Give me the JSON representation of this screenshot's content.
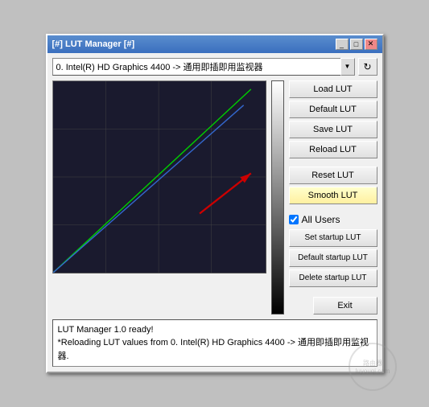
{
  "window": {
    "title": "[#] LUT Manager [#]",
    "title_bar_buttons": [
      "_",
      "□",
      "✕"
    ]
  },
  "toolbar": {
    "dropdown_value": "0. Intel(R) HD Graphics 4400 -> 通用即插即用监视器",
    "refresh_icon": "↻"
  },
  "buttons": {
    "load_lut": "Load LUT",
    "default_lut": "Default LUT",
    "save_lut": "Save LUT",
    "reload_lut": "Reload LUT",
    "reset_lut": "Reset LUT",
    "smooth_lut": "Smooth LUT",
    "all_users_label": "All Users",
    "set_startup_lut": "Set startup LUT",
    "default_startup_lut": "Default startup LUT",
    "delete_startup_lut": "Delete startup LUT",
    "exit": "Exit"
  },
  "status": {
    "line1": "LUT Manager 1.0 ready!",
    "line2": "*Reloading LUT values from 0. Intel(R) HD Graphics 4400 -> 通用即插即用监视器."
  },
  "chart": {
    "grid_lines": 4,
    "green_line": "diagonal",
    "blue_line": "diagonal_lower"
  }
}
